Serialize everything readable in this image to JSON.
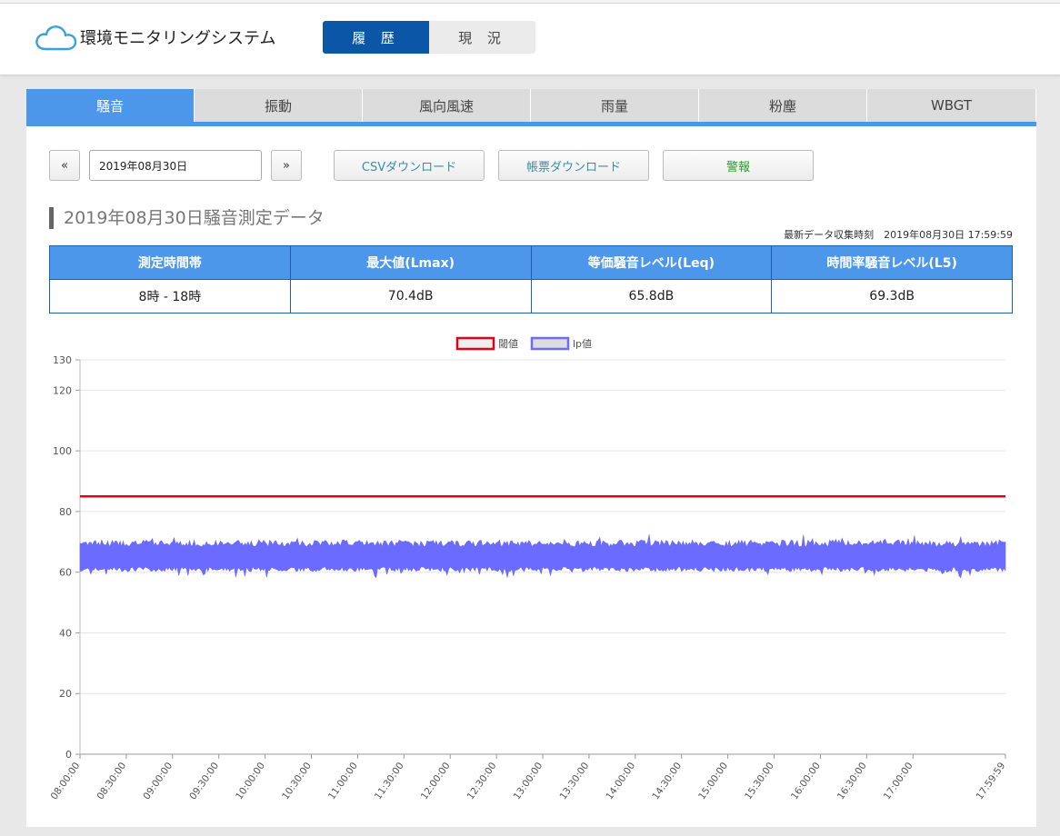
{
  "app": {
    "title": "環境モニタリングシステム"
  },
  "nav": {
    "history_label": "履 歴",
    "current_label": "現 況"
  },
  "tabs": [
    {
      "label": "騒音",
      "active": true
    },
    {
      "label": "振動",
      "active": false
    },
    {
      "label": "風向風速",
      "active": false
    },
    {
      "label": "雨量",
      "active": false
    },
    {
      "label": "粉塵",
      "active": false
    },
    {
      "label": "WBGT",
      "active": false
    }
  ],
  "controls": {
    "prev_label": "«",
    "next_label": "»",
    "date_value": "2019年08月30日",
    "csv_label": "CSVダウンロード",
    "report_label": "帳票ダウンロード",
    "alarm_label": "警報"
  },
  "section": {
    "title": "2019年08月30日騒音測定データ",
    "latest": "最新データ収集時刻　2019年08月30日 17:59:59"
  },
  "summary": {
    "headers": [
      "測定時間帯",
      "最大値(Lmax)",
      "等価騒音レベル(Leq)",
      "時間率騒音レベル(L5)"
    ],
    "values": [
      "8時 - 18時",
      "70.4dB",
      "65.8dB",
      "69.3dB"
    ]
  },
  "colors": {
    "accent": "#4d97eb",
    "nav_active": "#0c56a8",
    "threshold": "#e0001a",
    "lp": "#6b6bff",
    "csv_text": "#3a8fa6",
    "alarm_text": "#2ca02c"
  },
  "chart_data": {
    "type": "area",
    "legend": [
      "閾値",
      "lp値"
    ],
    "legend_position": "top-center",
    "ylim": [
      0,
      130
    ],
    "yticks": [
      0,
      20,
      40,
      60,
      80,
      100,
      120,
      130
    ],
    "xticks": [
      "08:00:00",
      "08:30:00",
      "09:00:00",
      "09:30:00",
      "10:00:00",
      "10:30:00",
      "11:00:00",
      "11:30:00",
      "12:00:00",
      "12:30:00",
      "13:00:00",
      "13:30:00",
      "14:00:00",
      "14:30:00",
      "15:00:00",
      "15:30:00",
      "16:00:00",
      "16:30:00",
      "17:00:00",
      "17:59:59"
    ],
    "x_range": [
      "08:00:00",
      "17:59:59"
    ],
    "grid": true,
    "series": [
      {
        "name": "閾値",
        "type": "line",
        "value": 85
      },
      {
        "name": "lp値",
        "type": "area-band",
        "low": 61,
        "high": 70
      }
    ]
  }
}
